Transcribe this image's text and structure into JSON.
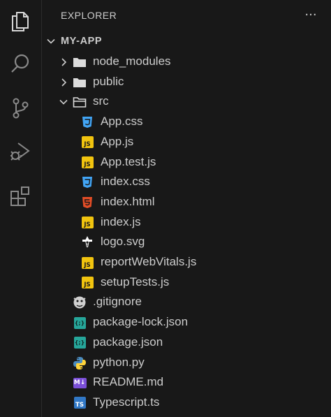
{
  "sidebar": {
    "title": "EXPLORER",
    "more_label": "···",
    "section_title": "MY-APP"
  },
  "tree": [
    {
      "label": "node_modules",
      "kind": "folder",
      "icon": "folder-icon",
      "expanded": false
    },
    {
      "label": "public",
      "kind": "folder",
      "icon": "folder-icon",
      "expanded": false
    },
    {
      "label": "src",
      "kind": "folder",
      "icon": "folder-open-icon",
      "expanded": true
    },
    {
      "label": "App.css",
      "kind": "file",
      "icon": "css-icon"
    },
    {
      "label": "App.js",
      "kind": "file",
      "icon": "js-icon"
    },
    {
      "label": "App.test.js",
      "kind": "file",
      "icon": "js-icon"
    },
    {
      "label": "index.css",
      "kind": "file",
      "icon": "css-icon"
    },
    {
      "label": "index.html",
      "kind": "file",
      "icon": "html-icon"
    },
    {
      "label": "index.js",
      "kind": "file",
      "icon": "js-icon"
    },
    {
      "label": "logo.svg",
      "kind": "file",
      "icon": "svg-icon"
    },
    {
      "label": "reportWebVitals.js",
      "kind": "file",
      "icon": "js-icon"
    },
    {
      "label": "setupTests.js",
      "kind": "file",
      "icon": "js-icon"
    },
    {
      "label": ".gitignore",
      "kind": "file",
      "icon": "git-icon"
    },
    {
      "label": "package-lock.json",
      "kind": "file",
      "icon": "json-icon"
    },
    {
      "label": "package.json",
      "kind": "file",
      "icon": "json-icon"
    },
    {
      "label": "python.py",
      "kind": "file",
      "icon": "python-icon"
    },
    {
      "label": "README.md",
      "kind": "file",
      "icon": "markdown-icon"
    },
    {
      "label": "Typescript.ts",
      "kind": "file",
      "icon": "typescript-icon"
    }
  ],
  "badge_text": {
    "js": "JS",
    "json": "{;}",
    "markdown": "M↓",
    "typescript": "TS"
  },
  "colors": {
    "background": "#181818",
    "text": "#cccccc",
    "js": "#f1c40f",
    "css": "#42a5f5",
    "html": "#e44d26",
    "json": "#26a69a",
    "markdown": "#7b4fd8",
    "typescript": "#3178c6"
  }
}
